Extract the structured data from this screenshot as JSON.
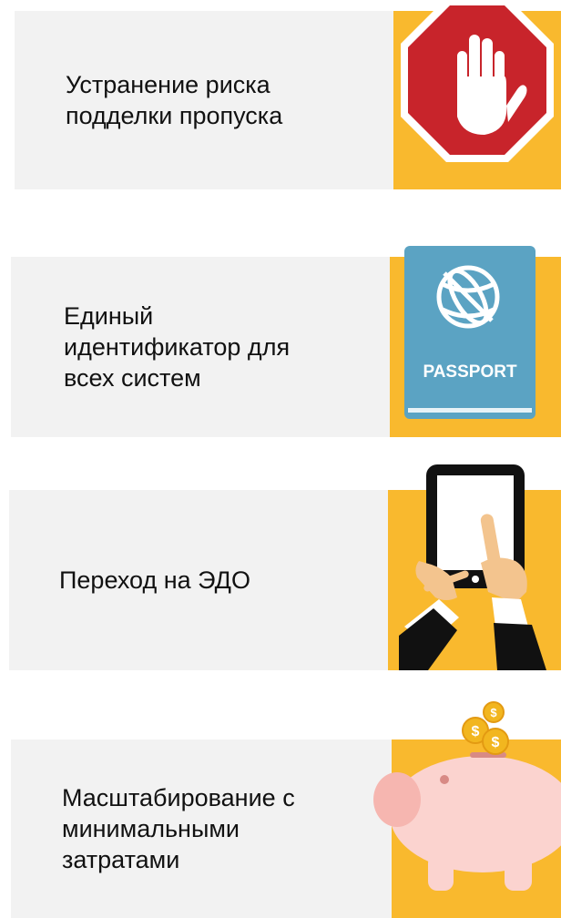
{
  "colors": {
    "card_bg": "#f2f2f2",
    "tile_bg": "#f9b92e",
    "text": "#111111"
  },
  "benefits": [
    {
      "lines": [
        "Устранение риска",
        "подделки пропуска"
      ],
      "icon": "stop-hand-icon"
    },
    {
      "lines": [
        "Единый",
        "идентификатор для",
        "всех систем"
      ],
      "icon": "passport-icon",
      "icon_text": "PASSPORT"
    },
    {
      "lines": [
        "Переход на ЭДО"
      ],
      "icon": "tablet-touch-icon"
    },
    {
      "lines": [
        "Масштабирование с",
        "минимальными",
        "затратами"
      ],
      "icon": "piggy-bank-coins-icon",
      "coin_symbol": "$"
    }
  ]
}
